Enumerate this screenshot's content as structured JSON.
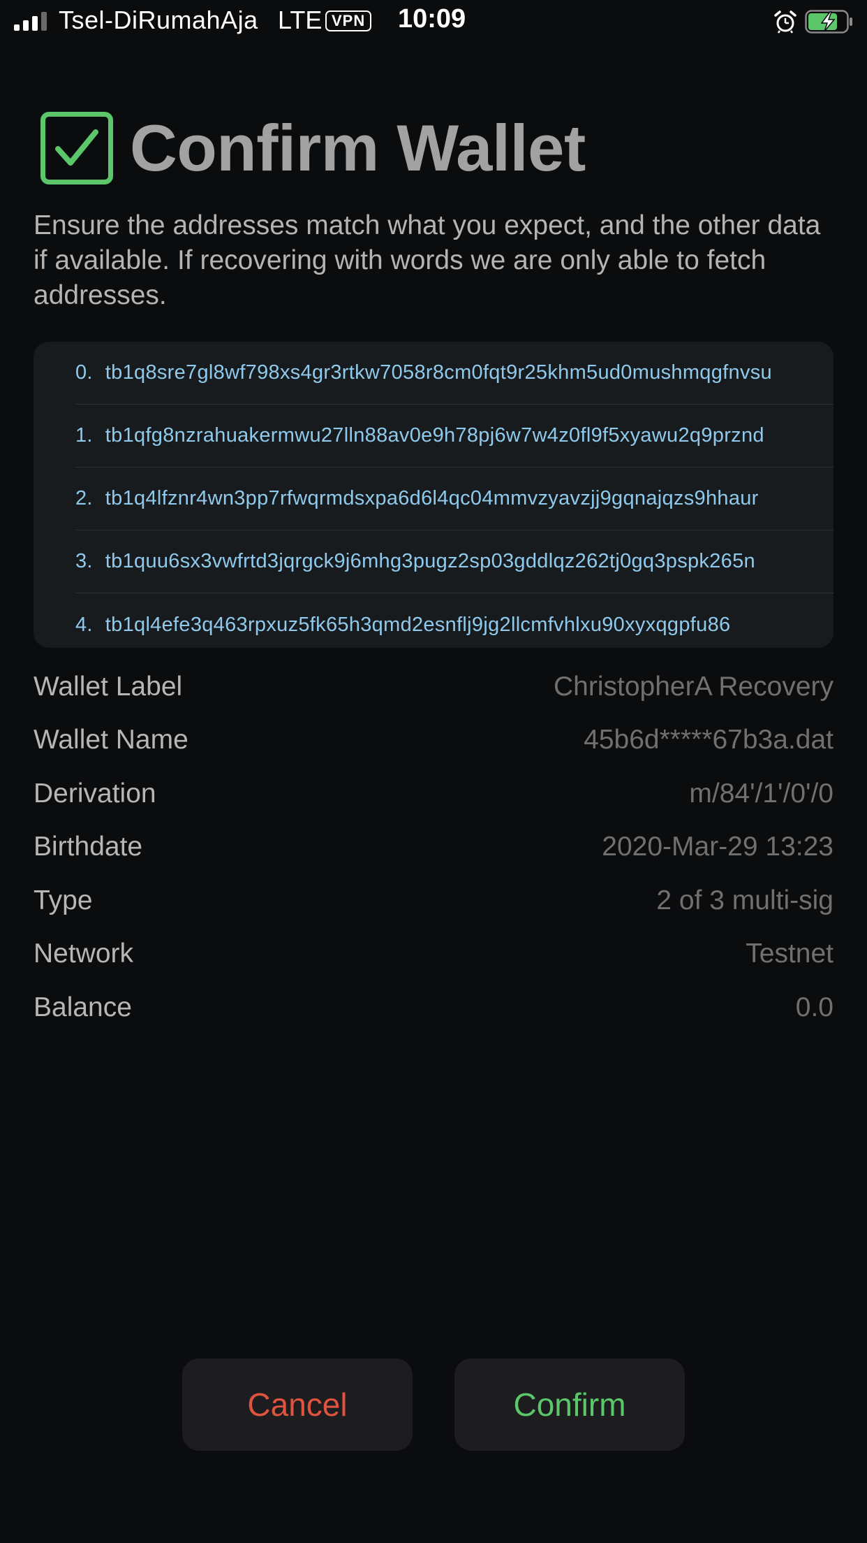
{
  "status_bar": {
    "carrier": "Tsel-DiRumahAja",
    "network": "LTE",
    "vpn": "VPN",
    "time": "10:09",
    "icons": [
      "signal-icon",
      "alarm-icon",
      "battery-charging-icon"
    ]
  },
  "header": {
    "icon": "checkbox-checked-icon",
    "title": "Confirm Wallet",
    "subtitle": "Ensure the addresses match what you expect, and the other data if available. If recovering with words we are only able to fetch addresses."
  },
  "addresses": [
    {
      "index": "0.",
      "address": "tb1q8sre7gl8wf798xs4gr3rtkw7058r8cm0fqt9r25khm5ud0mushmqgfnvsu"
    },
    {
      "index": "1.",
      "address": "tb1qfg8nzrahuakermwu27lln88av0e9h78pj6w7w4z0fl9f5xyawu2q9prznd"
    },
    {
      "index": "2.",
      "address": "tb1q4lfznr4wn3pp7rfwqrmdsxpa6d6l4qc04mmvzyavzjj9gqnajqzs9hhaur"
    },
    {
      "index": "3.",
      "address": "tb1quu6sx3vwfrtd3jqrgck9j6mhg3pugz2sp03gddlqz262tj0gq3pspk265n"
    },
    {
      "index": "4.",
      "address": "tb1ql4efe3q463rpxuz5fk65h3qmd2esnflj9jg2llcmfvhlxu90xyxqgpfu86"
    }
  ],
  "details": [
    {
      "label": "Wallet Label",
      "value": "ChristopherA Recovery"
    },
    {
      "label": "Wallet Name",
      "value": "45b6d*****67b3a.dat"
    },
    {
      "label": "Derivation",
      "value": "m/84'/1'/0'/0"
    },
    {
      "label": "Birthdate",
      "value": "2020-Mar-29 13:23"
    },
    {
      "label": "Type",
      "value": "2 of 3 multi-sig"
    },
    {
      "label": "Network",
      "value": "Testnet"
    },
    {
      "label": "Balance",
      "value": "0.0"
    }
  ],
  "buttons": {
    "cancel": "Cancel",
    "confirm": "Confirm"
  },
  "colors": {
    "background": "#0b0c0e",
    "accent_green": "#5cc66b",
    "cancel_red": "#e0533f",
    "address_blue": "#8fc9eb"
  }
}
